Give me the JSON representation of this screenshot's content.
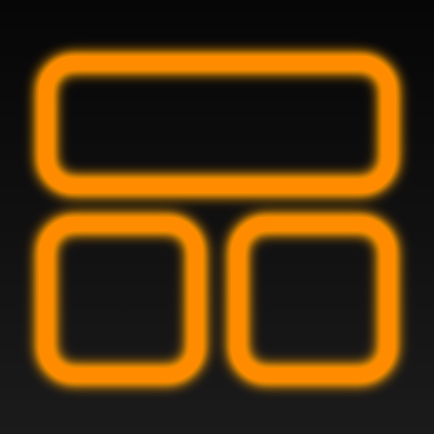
{
  "icon": {
    "semantic_name": "layout-dashboard-icon",
    "colors": {
      "background_top": "#060606",
      "background_bottom": "#1b1b1b",
      "stroke": "#ff8c00",
      "glow": "#ff6a00",
      "glow_dark": "#c83c00"
    }
  }
}
